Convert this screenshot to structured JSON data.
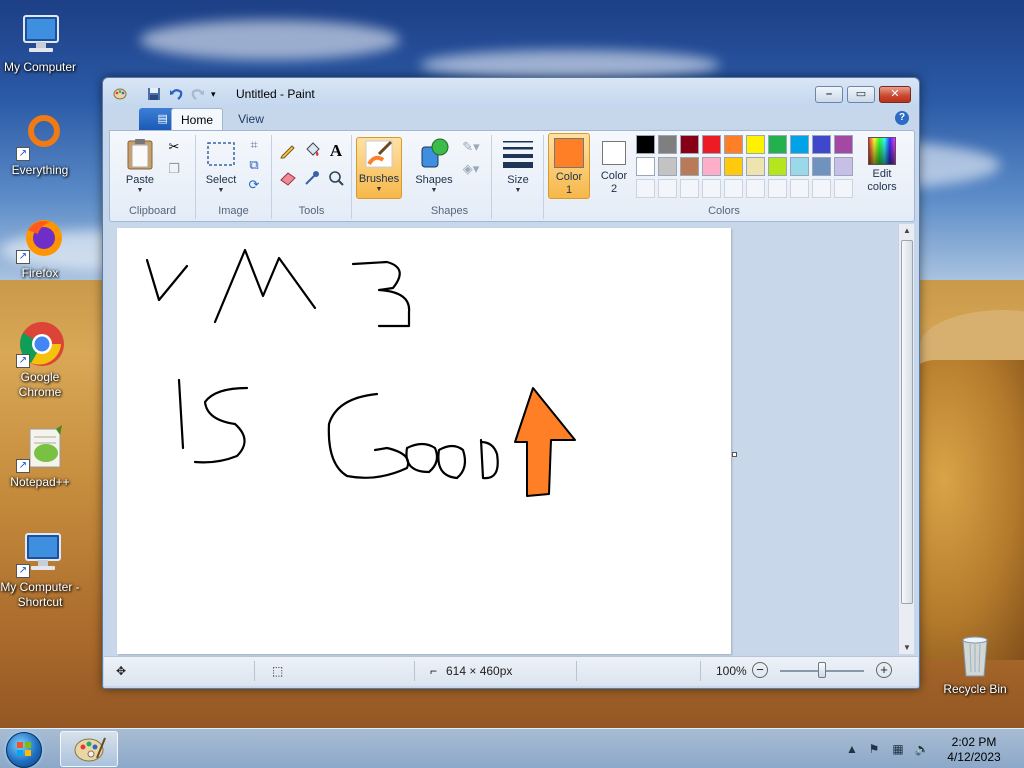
{
  "desktop": {
    "icons": [
      {
        "label": "My Computer"
      },
      {
        "label": "Everything"
      },
      {
        "label": "Firefox"
      },
      {
        "label": "Google Chrome"
      },
      {
        "label": "Notepad++"
      },
      {
        "label": "My Computer - Shortcut"
      },
      {
        "label": "Recycle Bin"
      }
    ]
  },
  "window": {
    "title": "Untitled - Paint",
    "tabs": [
      {
        "label": "Home",
        "active": true
      },
      {
        "label": "View",
        "active": false
      }
    ]
  },
  "ribbon": {
    "clipboard": {
      "label": "Clipboard",
      "paste": "Paste"
    },
    "image": {
      "label": "Image",
      "select": "Select"
    },
    "tools": {
      "label": "Tools"
    },
    "brushes": {
      "label": "Brushes"
    },
    "shapes": {
      "label": "Shapes",
      "shapes_btn": "Shapes"
    },
    "size": {
      "label": "Size"
    },
    "colors": {
      "label": "Colors",
      "color1_label": "Color",
      "color1_num": "1",
      "color2_label": "Color",
      "color2_num": "2",
      "color1": "#ff7f27",
      "color2": "#ffffff",
      "edit_colors_line1": "Edit",
      "edit_colors_line2": "colors",
      "palette_row1": [
        "#000000",
        "#7f7f7f",
        "#880015",
        "#ed1c24",
        "#ff7f27",
        "#fff200",
        "#22b14c",
        "#00a2e8",
        "#3f48cc",
        "#a349a4"
      ],
      "palette_row2": [
        "#ffffff",
        "#c3c3c3",
        "#b97a57",
        "#ffaec9",
        "#ffc90e",
        "#efe4b0",
        "#b5e61d",
        "#99d9ea",
        "#7092be",
        "#c8bfe7"
      ]
    }
  },
  "canvas": {
    "drawing_text": [
      "VM 3",
      "IS Good"
    ],
    "arrow_color": "#ff7f27"
  },
  "statusbar": {
    "dimensions": "614 × 460px",
    "zoom": "100%"
  },
  "taskbar": {
    "time": "2:02 PM",
    "date": "4/12/2023"
  }
}
